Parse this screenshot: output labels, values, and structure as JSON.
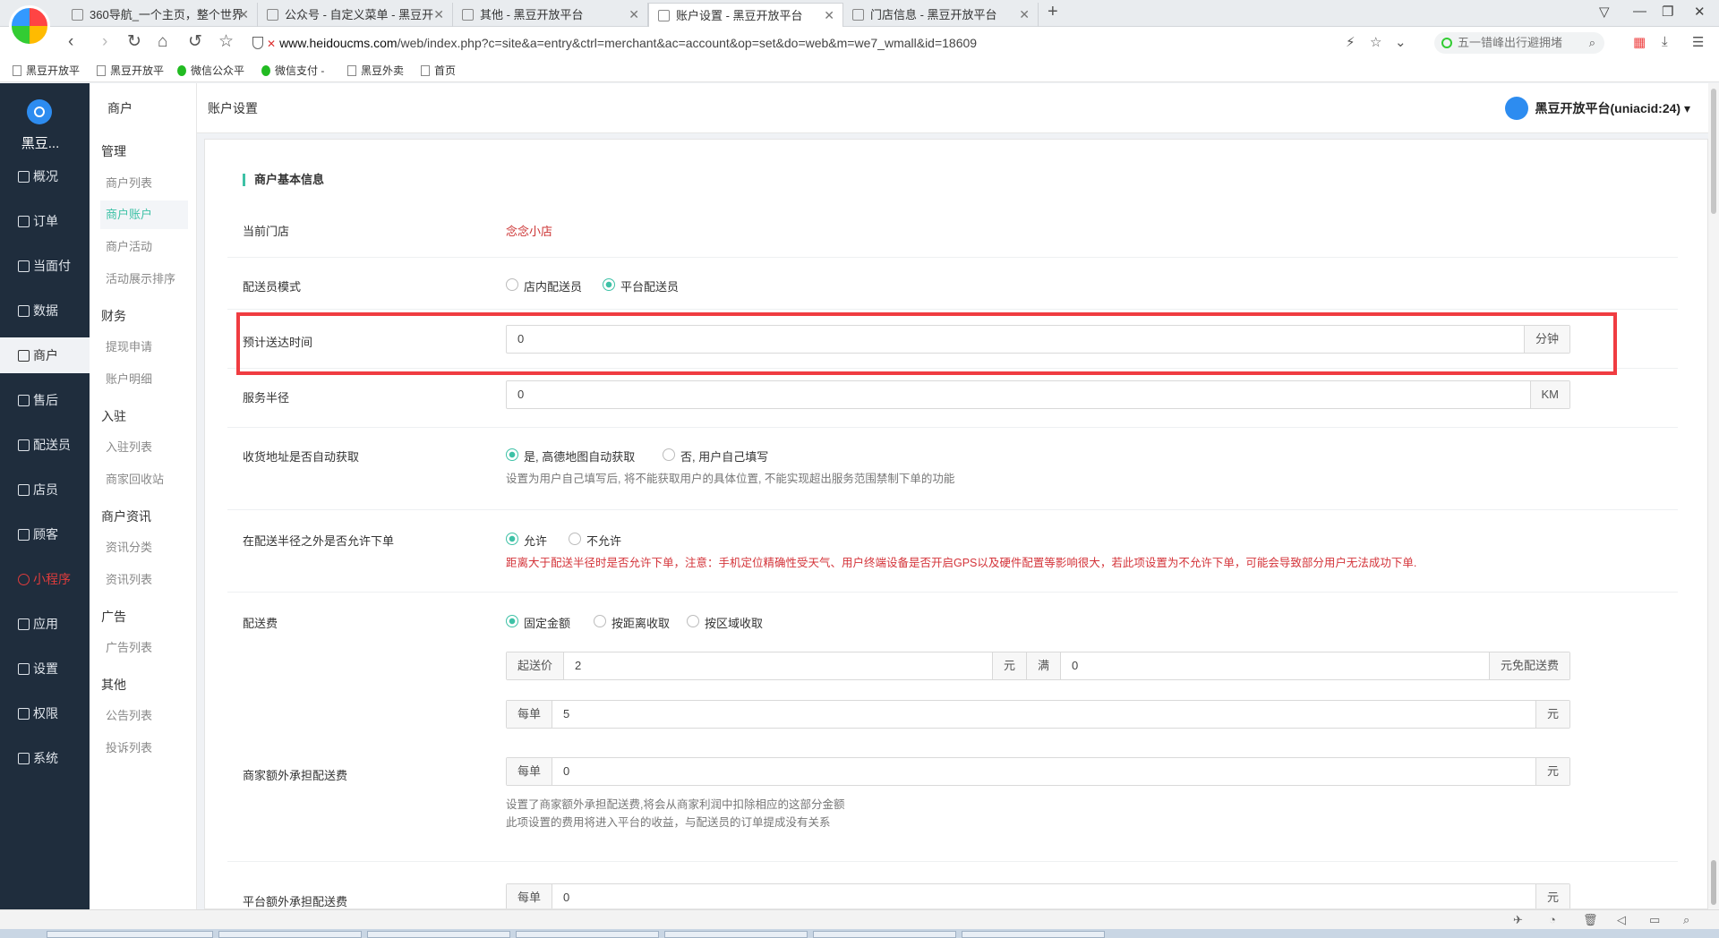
{
  "browser": {
    "tabs": [
      {
        "title": "360导航_一个主页，整个世界"
      },
      {
        "title": "公众号 - 自定义菜单 - 黑豆开"
      },
      {
        "title": "其他 - 黑豆开放平台"
      },
      {
        "title": "账户设置 - 黑豆开放平台"
      },
      {
        "title": "门店信息 - 黑豆开放平台"
      }
    ],
    "url_host": "www.heidoucms.com",
    "url_path": "/web/index.php?c=site&a=entry&ctrl=merchant&ac=account&op=set&do=web&m=we7_wmall&id=18609",
    "search_placeholder": "五一错峰出行避拥堵",
    "bookmarks": [
      "黑豆开放平",
      "黑豆开放平",
      "微信公众平",
      "微信支付 -",
      "黑豆外卖",
      "首页"
    ]
  },
  "app": {
    "name": "黑豆...",
    "nav": [
      "概况",
      "订单",
      "当面付",
      "数据",
      "商户",
      "售后",
      "配送员",
      "店员",
      "顾客",
      "小程序",
      "应用",
      "设置",
      "权限",
      "系统"
    ],
    "submenu_title": "商户",
    "submenu": [
      {
        "group": "管理",
        "items": [
          "商户列表",
          "商户账户",
          "商户活动",
          "活动展示排序"
        ]
      },
      {
        "group": "财务",
        "items": [
          "提现申请",
          "账户明细"
        ]
      },
      {
        "group": "入驻",
        "items": [
          "入驻列表",
          "商家回收站"
        ]
      },
      {
        "group": "商户资讯",
        "items": [
          "资讯分类",
          "资讯列表"
        ]
      },
      {
        "group": "广告",
        "items": [
          "广告列表"
        ]
      },
      {
        "group": "其他",
        "items": [
          "公告列表",
          "投诉列表"
        ]
      }
    ],
    "breadcrumb": "账户设置",
    "account": "黑豆开放平台(uniacid:24)"
  },
  "form": {
    "section_title": "商户基本信息",
    "current_store_label": "当前门店",
    "current_store_value": "念念小店",
    "courier_mode": {
      "label": "配送员模式",
      "options": [
        "店内配送员",
        "平台配送员"
      ]
    },
    "eta": {
      "label": "预计送达时间",
      "value": "0",
      "unit": "分钟"
    },
    "radius": {
      "label": "服务半径",
      "value": "0",
      "unit": "KM"
    },
    "auto_address": {
      "label": "收货地址是否自动获取",
      "options": [
        "是, 高德地图自动获取",
        "否, 用户自己填写"
      ],
      "help": "设置为用户自己填写后, 将不能获取用户的具体位置, 不能实现超出服务范围禁制下单的功能"
    },
    "outside_radius": {
      "label": "在配送半径之外是否允许下单",
      "options": [
        "允许",
        "不允许"
      ],
      "help": "距离大于配送半径时是否允许下单，注意：手机定位精确性受天气、用户终端设备是否开启GPS以及硬件配置等影响很大，若此项设置为不允许下单，可能会导致部分用户无法成功下单."
    },
    "delivery_fee": {
      "label": "配送费",
      "options": [
        "固定金额",
        "按距离收取",
        "按区域收取"
      ],
      "min_label": "起送价",
      "min_value": "2",
      "min_unit": "元",
      "free_label": "满",
      "free_value": "0",
      "free_unit": "元免配送费",
      "per_label": "每单",
      "per_value": "5",
      "per_unit": "元"
    },
    "merchant_extra": {
      "label": "商家额外承担配送费",
      "prefix": "每单",
      "value": "0",
      "unit": "元",
      "help1": "设置了商家额外承担配送费,将会从商家利润中扣除相应的这部分金额",
      "help2": "此项设置的费用将进入平台的收益，与配送员的订单提成没有关系"
    },
    "platform_extra": {
      "label": "平台额外承担配送费",
      "prefix": "每单",
      "value": "0",
      "unit": "元"
    }
  },
  "colors": {
    "accent": "#3ec1a6",
    "highlight": "#f03c41",
    "sidebar": "#1f2d3d"
  }
}
